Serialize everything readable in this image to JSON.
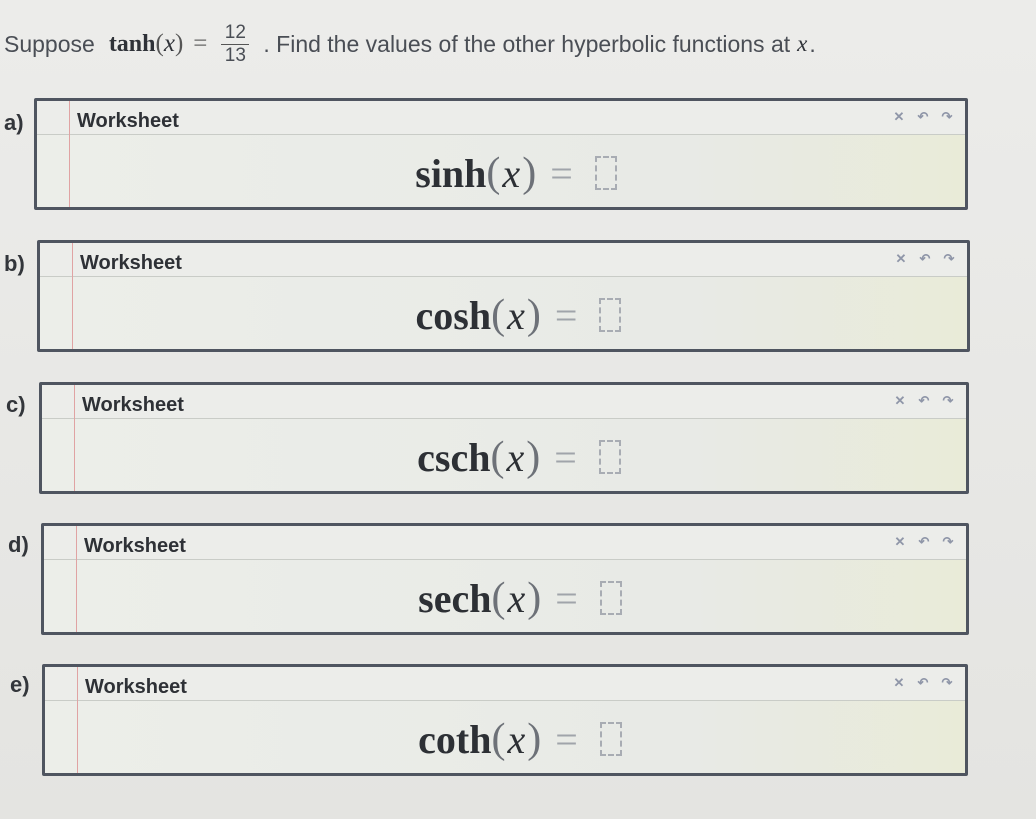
{
  "question": {
    "prefix": "Suppose",
    "function": "tanh",
    "open_paren": "(",
    "variable": "x",
    "close_paren": ")",
    "equals": "=",
    "numerator": "12",
    "denominator": "13",
    "suffix": ". Find the values of the other hyperbolic functions at",
    "suffix_variable": "x",
    "end": "."
  },
  "worksheet_title": "Worksheet",
  "toolbar": {
    "clear_icon": "clear-x-icon",
    "undo_icon": "undo-arrow-icon",
    "redo_icon": "redo-arrow-icon",
    "clear_glyph": "✕",
    "undo_glyph": "↶",
    "redo_glyph": "↷"
  },
  "parts": [
    {
      "label": "a)",
      "function": "sinh",
      "variable": "x",
      "equals": "="
    },
    {
      "label": "b)",
      "function": "cosh",
      "variable": "x",
      "equals": "="
    },
    {
      "label": "c)",
      "function": "csch",
      "variable": "x",
      "equals": "="
    },
    {
      "label": "d)",
      "function": "sech",
      "variable": "x",
      "equals": "="
    },
    {
      "label": "e)",
      "function": "coth",
      "variable": "x",
      "equals": "="
    }
  ]
}
